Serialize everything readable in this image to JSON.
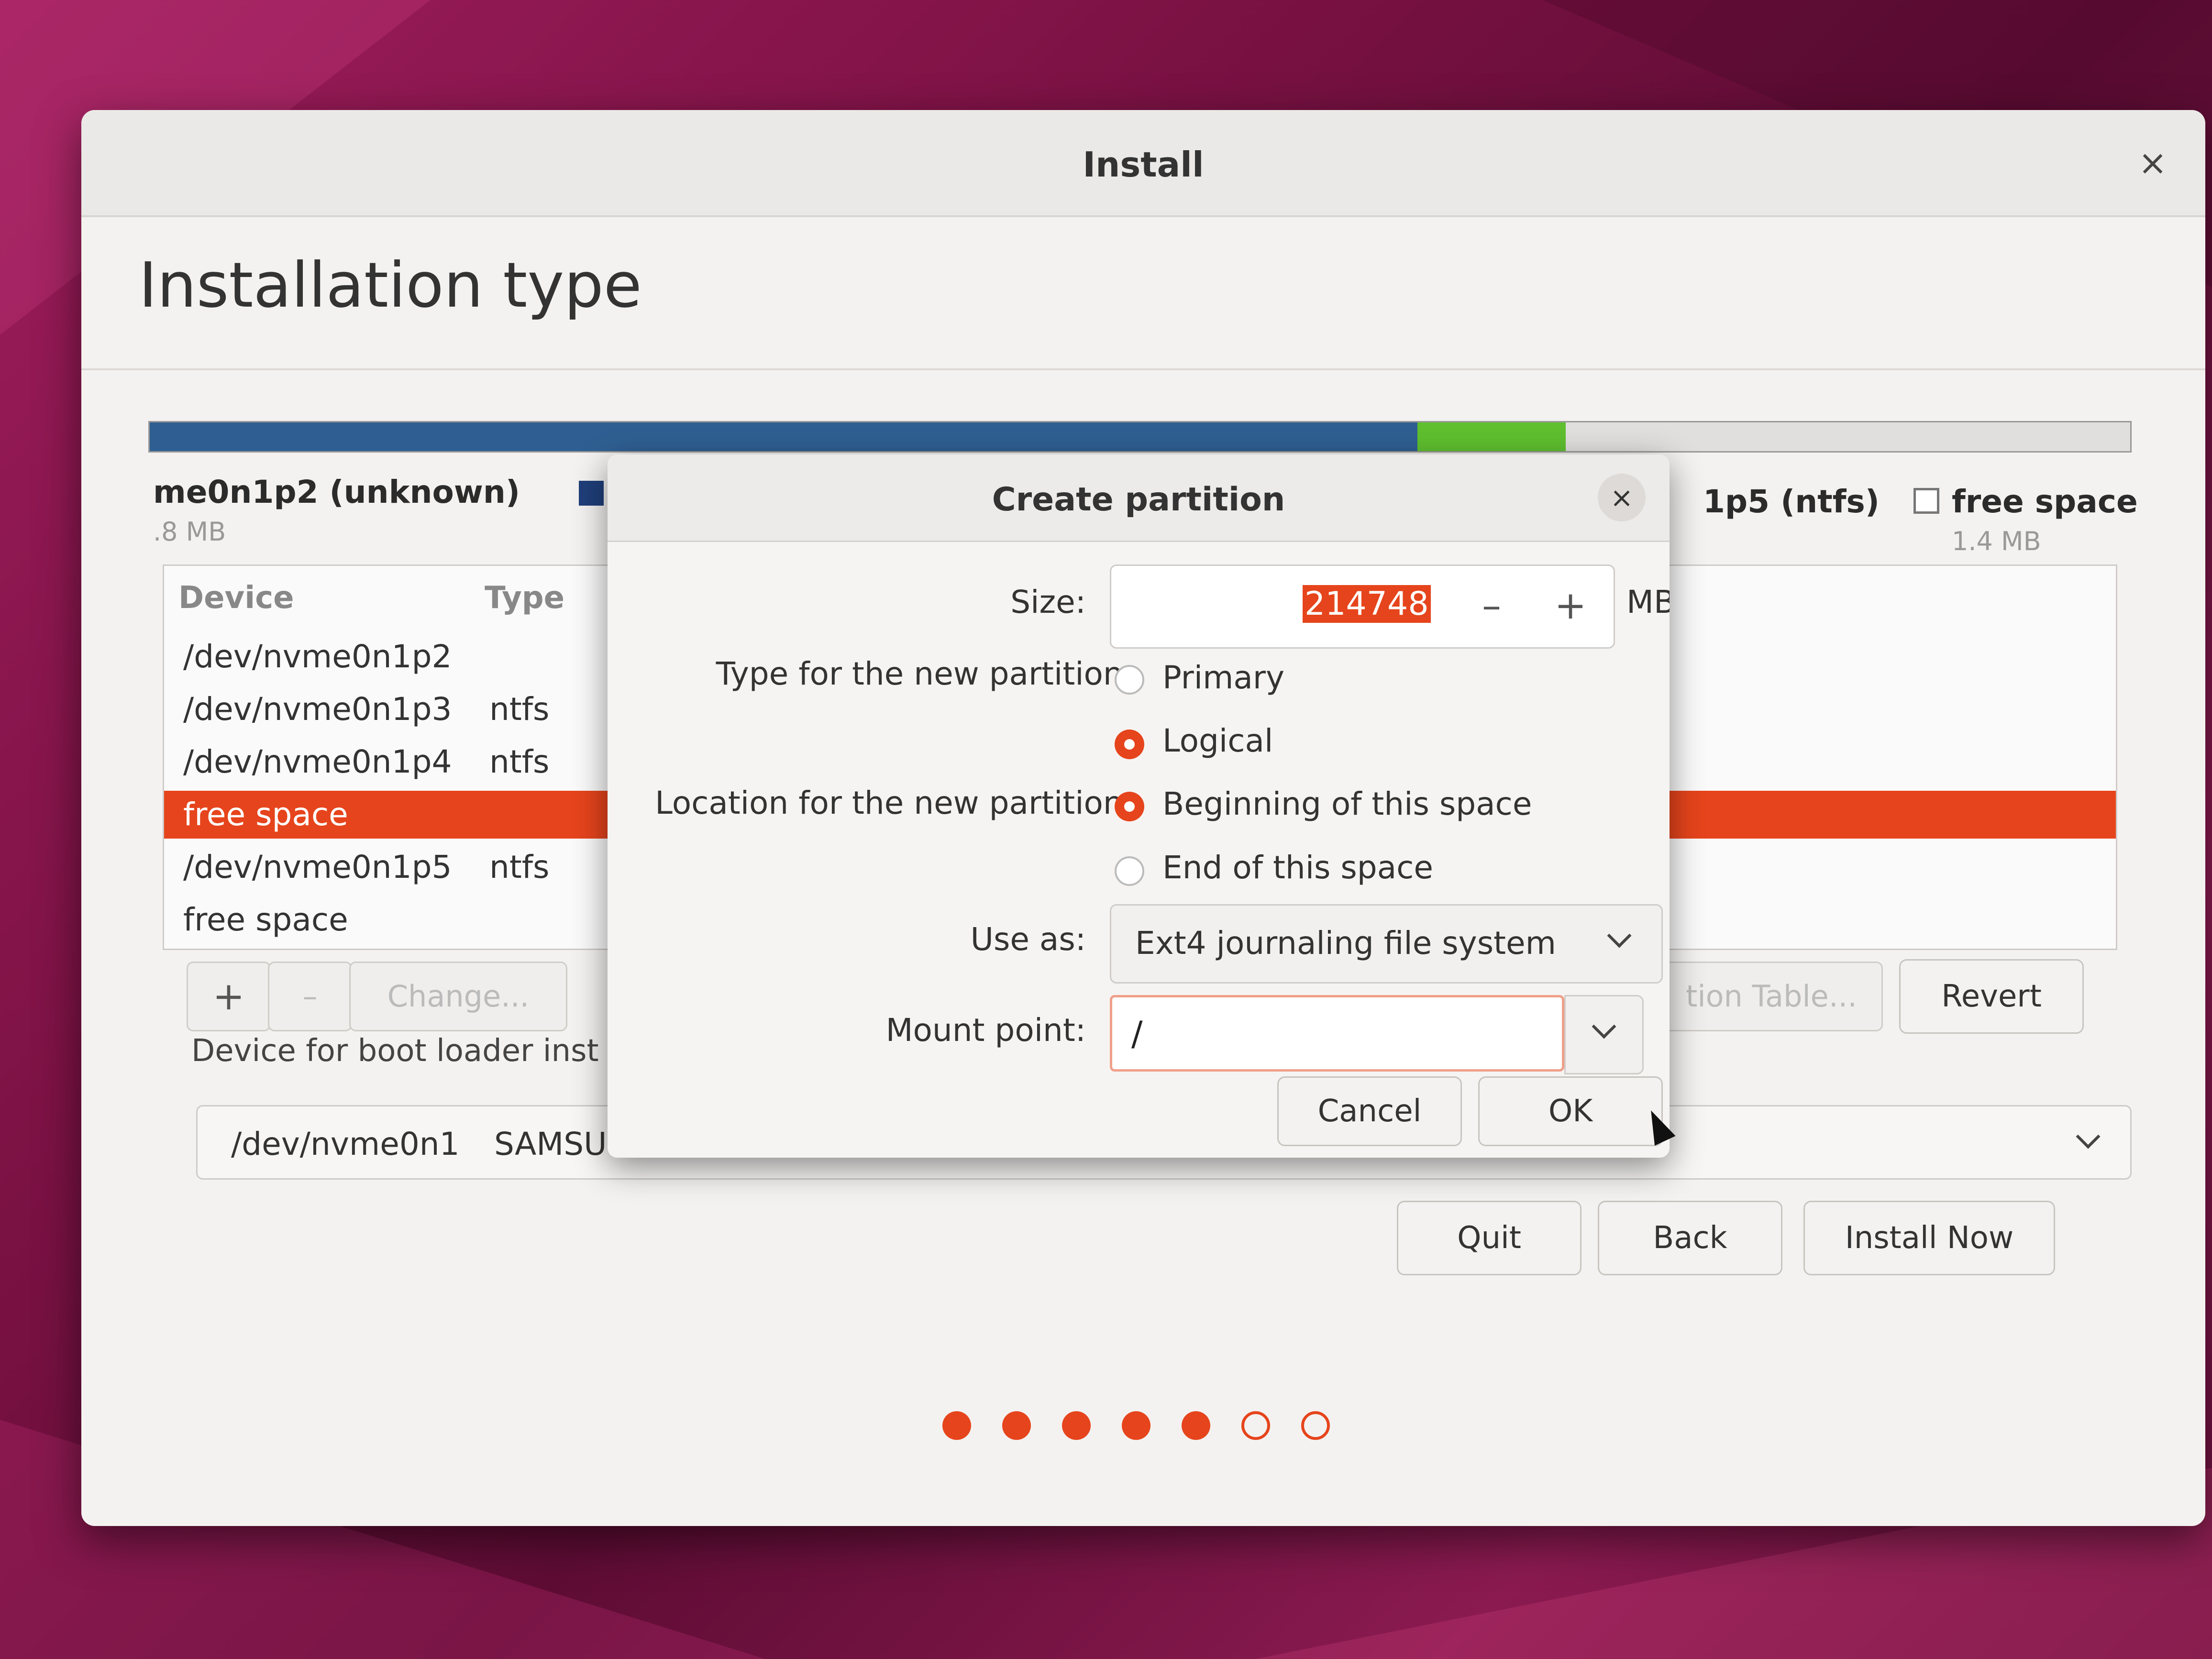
{
  "window": {
    "title": "Install",
    "close_glyph": "×"
  },
  "page": {
    "heading": "Installation type"
  },
  "partition_bar": {
    "segments": [
      {
        "color": "#2f5f92",
        "fraction": 0.64
      },
      {
        "color": "#5fbf2f",
        "fraction": 0.075
      },
      {
        "color": "#e0dfdd",
        "fraction": 0.285
      }
    ]
  },
  "legend": {
    "left_name": "me0n1p2 (unknown)",
    "left_size": ".8 MB",
    "left_swatch_color": "#1f3f7a",
    "right_name": "1p5 (ntfs)",
    "free_name": "free space",
    "free_size": "1.4 MB"
  },
  "table": {
    "headers": {
      "device": "Device",
      "type": "Type"
    },
    "rows": [
      {
        "device": "/dev/nvme0n1p2",
        "type": "",
        "selected": false
      },
      {
        "device": "/dev/nvme0n1p3",
        "type": "ntfs",
        "selected": false
      },
      {
        "device": "/dev/nvme0n1p4",
        "type": "ntfs",
        "selected": false
      },
      {
        "device": "free space",
        "type": "",
        "selected": true
      },
      {
        "device": "/dev/nvme0n1p5",
        "type": "ntfs",
        "selected": false
      },
      {
        "device": "free space",
        "type": "",
        "selected": false
      }
    ],
    "add_glyph": "+",
    "remove_glyph": "–",
    "change_label": "Change...",
    "new_table_label": "tion Table...",
    "revert_label": "Revert"
  },
  "bootloader": {
    "label": "Device for boot loader inst",
    "device": "/dev/nvme0n1",
    "model": "SAMSU"
  },
  "nav": {
    "quit": "Quit",
    "back": "Back",
    "install_now": "Install Now"
  },
  "progress": {
    "total": 7,
    "completed": 5,
    "accent": "#e6441c"
  },
  "dialog": {
    "title": "Create partition",
    "close_glyph": "×",
    "size_label": "Size:",
    "size_value": "214748",
    "minus_glyph": "–",
    "plus_glyph": "+",
    "unit": "MB",
    "type_label": "Type for the new partition:",
    "type_primary": "Primary",
    "type_logical": "Logical",
    "location_label": "Location for the new partition:",
    "loc_begin": "Beginning of this space",
    "loc_end": "End of this space",
    "use_as_label": "Use as:",
    "use_as_value": "Ext4 journaling file system",
    "mount_label": "Mount point:",
    "mount_value": "/",
    "cancel": "Cancel",
    "ok": "OK"
  }
}
